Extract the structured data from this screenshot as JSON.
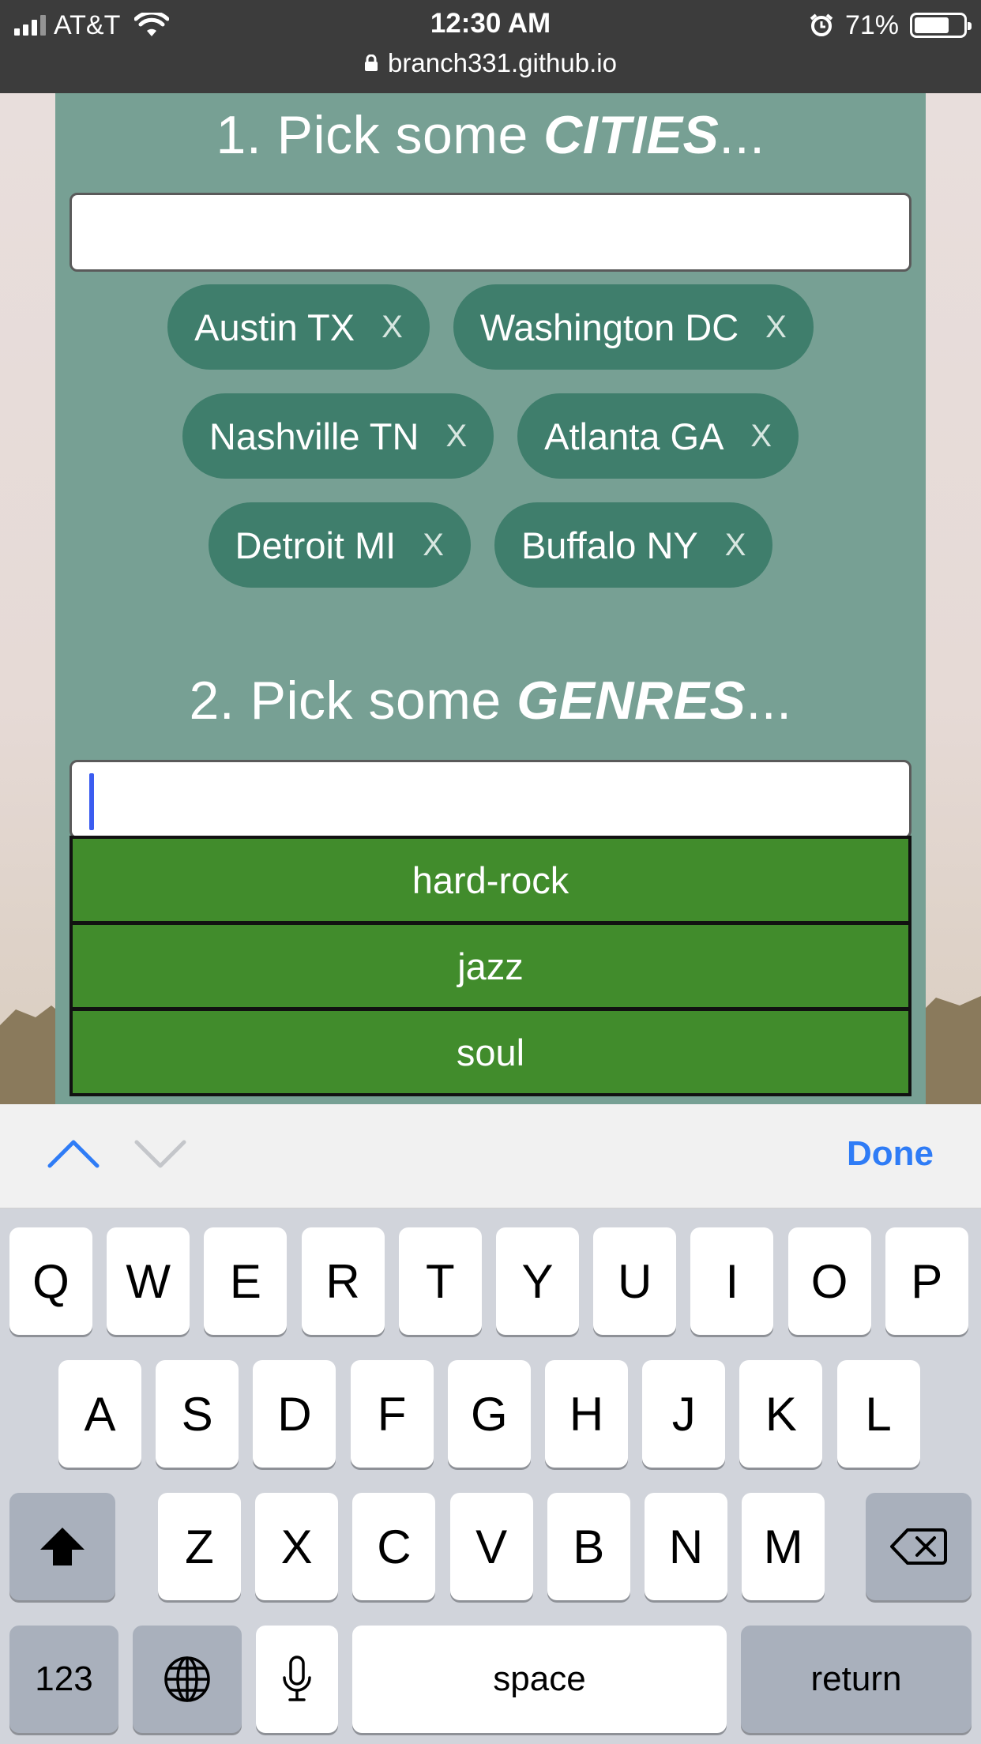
{
  "status_bar": {
    "carrier": "AT&T",
    "time": "12:30 AM",
    "battery": "71%",
    "battery_level": 0.71,
    "url": "branch331.github.io"
  },
  "cities_section": {
    "heading_prefix": "1. Pick some ",
    "heading_emphasis": "CITIES",
    "heading_suffix": "...",
    "input_value": "",
    "chips": [
      {
        "label": "Austin TX",
        "remove": "X"
      },
      {
        "label": "Washington DC",
        "remove": "X"
      },
      {
        "label": "Nashville TN",
        "remove": "X"
      },
      {
        "label": "Atlanta GA",
        "remove": "X"
      },
      {
        "label": "Detroit MI",
        "remove": "X"
      },
      {
        "label": "Buffalo NY",
        "remove": "X"
      }
    ]
  },
  "genres_section": {
    "heading_prefix": "2. Pick some ",
    "heading_emphasis": "GENRES",
    "heading_suffix": "...",
    "input_value": "",
    "suggestions": [
      "hard-rock",
      "jazz",
      "soul"
    ]
  },
  "accessory": {
    "done_label": "Done",
    "up_icon": "chevron-up-icon",
    "down_icon": "chevron-down-icon"
  },
  "keyboard": {
    "row1": [
      "Q",
      "W",
      "E",
      "R",
      "T",
      "Y",
      "U",
      "I",
      "O",
      "P"
    ],
    "row2": [
      "A",
      "S",
      "D",
      "F",
      "G",
      "H",
      "J",
      "K",
      "L"
    ],
    "row3": [
      "Z",
      "X",
      "C",
      "V",
      "B",
      "N",
      "M"
    ],
    "numbers_label": "123",
    "space_label": "space",
    "return_label": "return"
  },
  "colors": {
    "panel": "#77a094",
    "chip": "#3f7e6c",
    "suggestion": "#418c2c",
    "accent": "#2f7cf6"
  }
}
